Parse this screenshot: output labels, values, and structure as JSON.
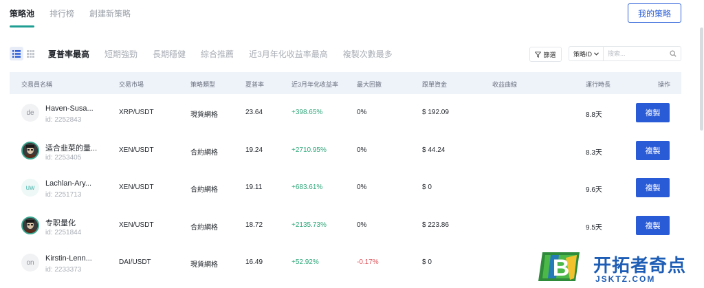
{
  "top_tabs": [
    "策略池",
    "排行榜",
    "創建新策略"
  ],
  "my_strategy_label": "我的策略",
  "sort_tabs": [
    "夏普率最高",
    "短期強勁",
    "長期穩健",
    "綜合推薦",
    "近3月年化收益率最高",
    "複製次數最多"
  ],
  "filter_label": "篩選",
  "search": {
    "select_label": "策略ID",
    "placeholder": "搜索..."
  },
  "columns": [
    "交易員名稱",
    "交易市場",
    "策略類型",
    "夏普率",
    "近3月年化收益率",
    "最大回撤",
    "跟單資金",
    "收益曲線",
    "運行時長",
    "操作"
  ],
  "rows": [
    {
      "avatar": "de",
      "name": "Haven-Susa...",
      "id": "id: 2252843",
      "market": "XRP/USDT",
      "type": "現貨網格",
      "sharpe": "23.64",
      "return": "+398.65%",
      "drawdown": "0%",
      "funds": "$ 192.09",
      "runtime": "8.8天",
      "action": "複製"
    },
    {
      "avatar": "",
      "name": "适合韭菜的量...",
      "id": "id: 2253405",
      "market": "XEN/USDT",
      "type": "合約網格",
      "sharpe": "19.24",
      "return": "+2710.95%",
      "drawdown": "0%",
      "funds": "$ 44.24",
      "runtime": "8.3天",
      "action": "複製"
    },
    {
      "avatar": "uw",
      "name": "Lachlan-Ary...",
      "id": "id: 2251713",
      "market": "XEN/USDT",
      "type": "合約網格",
      "sharpe": "19.11",
      "return": "+683.61%",
      "drawdown": "0%",
      "funds": "$ 0",
      "runtime": "9.6天",
      "action": "複製"
    },
    {
      "avatar": "",
      "name": "专职量化",
      "id": "id: 2251844",
      "market": "XEN/USDT",
      "type": "合約網格",
      "sharpe": "18.72",
      "return": "+2135.73%",
      "drawdown": "0%",
      "funds": "$ 223.86",
      "runtime": "9.5天",
      "action": "複製"
    },
    {
      "avatar": "on",
      "name": "Kirstin-Lenn...",
      "id": "id: 2233373",
      "market": "DAI/USDT",
      "type": "現貨網格",
      "sharpe": "16.49",
      "return": "+52.92%",
      "drawdown": "-0.17%",
      "funds": "$ 0",
      "runtime": "",
      "action": ""
    }
  ],
  "watermark": {
    "logo_letter": "B",
    "text": "开拓者奇点",
    "url": "JSKTZ.COM"
  },
  "colors": {
    "accent": "#2a5bd7",
    "positive": "#2ea77a",
    "negative": "#e0545a",
    "tab_underline": "#1f9e93"
  }
}
